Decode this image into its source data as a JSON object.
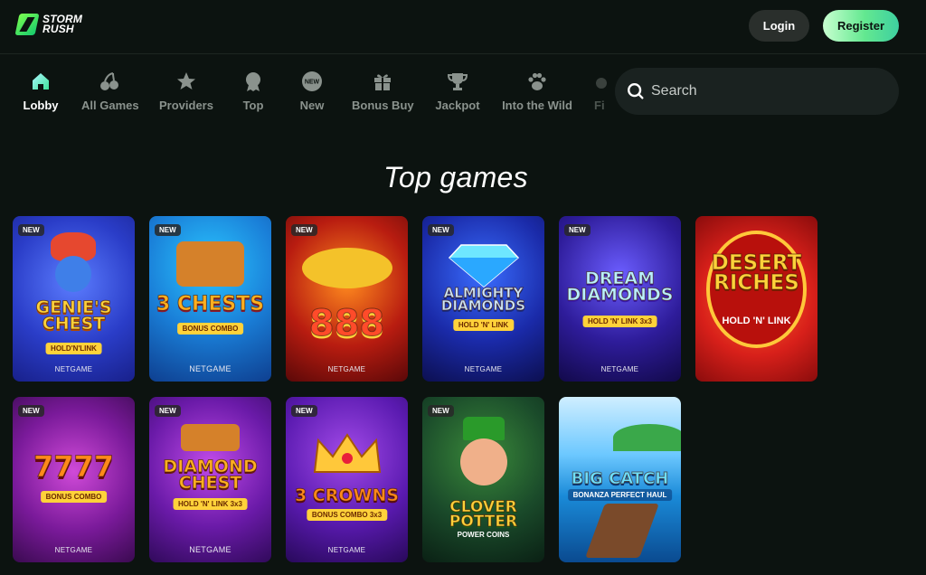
{
  "header": {
    "logo_line1": "STORM",
    "logo_line2": "RUSH",
    "login_label": "Login",
    "register_label": "Register"
  },
  "nav": {
    "items": [
      {
        "label": "Lobby",
        "icon": "home-icon",
        "active": true
      },
      {
        "label": "All Games",
        "icon": "cherries-icon"
      },
      {
        "label": "Providers",
        "icon": "star-icon"
      },
      {
        "label": "Top",
        "icon": "badge-icon"
      },
      {
        "label": "New",
        "icon": "new-icon",
        "icon_text": "NEW"
      },
      {
        "label": "Bonus Buy",
        "icon": "gift-icon"
      },
      {
        "label": "Jackpot",
        "icon": "trophy-icon"
      },
      {
        "label": "Into the Wild",
        "icon": "paw-icon"
      },
      {
        "label": "Fi",
        "icon": "fruit-icon"
      }
    ]
  },
  "search": {
    "placeholder": "Search"
  },
  "section": {
    "title": "Top games"
  },
  "games": [
    {
      "title": "GENIE'S CHEST",
      "subtitle": "HOLD'N'LINK",
      "provider": "NETGAME",
      "badge": "NEW"
    },
    {
      "title": "3 CHESTS",
      "subtitle": "BONUS COMBO",
      "provider": "NETGAME",
      "badge": "NEW"
    },
    {
      "title": "888",
      "subtitle": "",
      "provider": "NETGAME",
      "badge": "NEW"
    },
    {
      "title": "ALMIGHTY DIAMONDS",
      "subtitle": "HOLD 'N' LINK",
      "provider": "NETGAME",
      "badge": "NEW"
    },
    {
      "title": "DREAM DIAMONDS",
      "subtitle": "HOLD 'N' LINK 3x3",
      "provider": "NETGAME",
      "badge": "NEW"
    },
    {
      "title": "DESERT RICHES",
      "subtitle": "HOLD 'N' LINK",
      "provider": "",
      "badge": ""
    },
    {
      "title": "7777",
      "subtitle": "BONUS COMBO",
      "provider": "NETGAME",
      "badge": "NEW"
    },
    {
      "title": "DIAMOND CHEST",
      "subtitle": "HOLD 'N' LINK 3x3",
      "provider": "NETGAME",
      "badge": "NEW"
    },
    {
      "title": "3 CROWNS",
      "subtitle": "BONUS COMBO 3x3",
      "provider": "NETGAME",
      "badge": "NEW"
    },
    {
      "title": "CLOVER POTTER",
      "subtitle": "POWER COINS",
      "provider": "",
      "badge": "NEW"
    },
    {
      "title": "BIG CATCH",
      "subtitle": "BONANZA PERFECT HAUL",
      "provider": "",
      "badge": ""
    }
  ],
  "colors": {
    "background": "#0c1310",
    "accent_green": "#63e890",
    "nav_inactive": "#8a928d"
  }
}
